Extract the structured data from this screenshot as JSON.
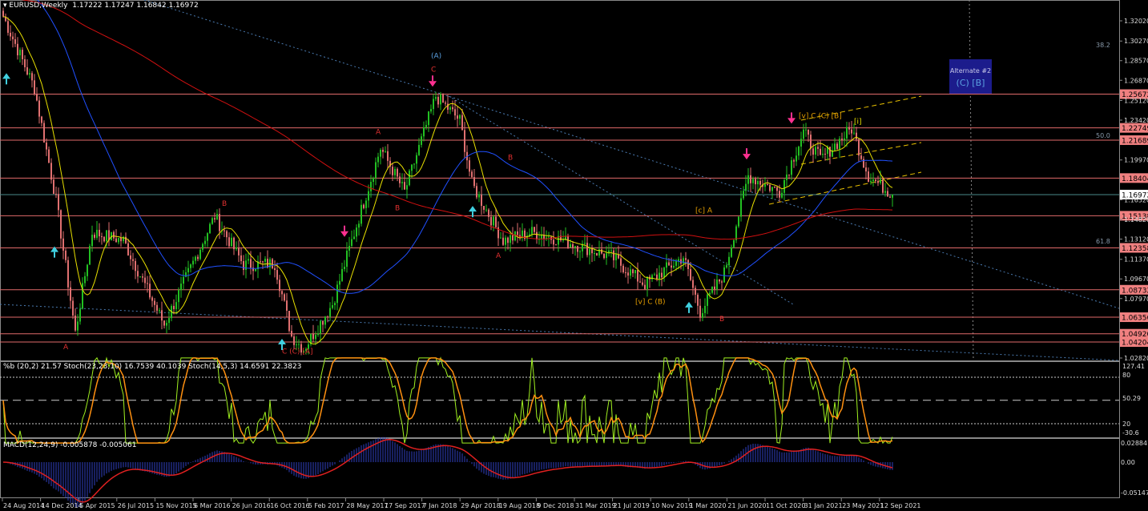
{
  "header": {
    "symbol": "EURUSD,Weekly",
    "ohlc": "1.17222 1.17247 1.16842 1.16972"
  },
  "indicator_header": "%b (20,2) 21.57  Stoch(23,23,10) 16.7539 40.1039  Stoch(14,5,3) 14.6591 22.3823",
  "macd_header": "MACD(12,24,9) -0.005878 -0.005061",
  "alternate_box": {
    "title": "Alternate #2",
    "labels": "(C)  [B]"
  },
  "colors": {
    "bull": "#22c022",
    "bear": "#e07070",
    "level": "#e06a6a",
    "ma_fast": "#e8e000",
    "ma_mid": "#2050ff",
    "ma_slow": "#d01010",
    "stoch": "#a0f020",
    "stoch_signal": "#ff9010",
    "macd_signal": "#e02020",
    "macd_hist": "#3040c0"
  },
  "chart_data": {
    "type": "candlestick",
    "title": "EURUSD,Weekly",
    "ylim": [
      1.0282,
      1.3202
    ],
    "price_ticks": [
      "1.32020",
      "1.30270",
      "1.28570",
      "1.26870",
      "1.25120",
      "1.23420",
      "1.19970",
      "1.16520",
      "1.14820",
      "1.13120",
      "1.11370",
      "1.09670",
      "1.07970",
      "1.02820"
    ],
    "levels": [
      1.25672,
      1.22749,
      1.21689,
      1.18404,
      1.15138,
      1.12358,
      1.08732,
      1.06356,
      1.0492,
      1.04204
    ],
    "level_labels": [
      "1.25672",
      "1.22749",
      "1.21689",
      "1.18404",
      "1.15138",
      "1.12358",
      "1.08732",
      "1.06356",
      "1.04920",
      "1.04204"
    ],
    "current_price": 1.16972,
    "current_price_label": "1.16972",
    "fib_labels": [
      {
        "text": "38.2",
        "price": 1.296
      },
      {
        "text": "50.0",
        "price": 1.2175
      },
      {
        "text": "61.8",
        "price": 1.126
      }
    ],
    "x_labels": [
      "24 Aug 2014",
      "14 Dec 2014",
      "5 Apr 2015",
      "26 Jul 2015",
      "15 Nov 2015",
      "6 Mar 2016",
      "26 Jun 2016",
      "16 Oct 2016",
      "5 Feb 2017",
      "28 May 2017",
      "17 Sep 2017",
      "7 Jan 2018",
      "29 Apr 2018",
      "19 Aug 2018",
      "9 Dec 2018",
      "31 Mar 2019",
      "21 Jul 2019",
      "10 Nov 2019",
      "1 Mar 2020",
      "21 Jun 2020",
      "11 Oct 2020",
      "31 Jan 2021",
      "23 May 2021",
      "12 Sep 2021"
    ],
    "close_path_week_price": [
      [
        0,
        1.324
      ],
      [
        13,
        1.262
      ],
      [
        22,
        1.165
      ],
      [
        30,
        1.05
      ],
      [
        37,
        1.137
      ],
      [
        50,
        1.13
      ],
      [
        67,
        1.057
      ],
      [
        88,
        1.151
      ],
      [
        100,
        1.109
      ],
      [
        113,
        1.11
      ],
      [
        120,
        1.047
      ],
      [
        125,
        1.036
      ],
      [
        137,
        1.075
      ],
      [
        143,
        1.116
      ],
      [
        157,
        1.21
      ],
      [
        167,
        1.172
      ],
      [
        180,
        1.255
      ],
      [
        190,
        1.234
      ],
      [
        195,
        1.179
      ],
      [
        208,
        1.13
      ],
      [
        220,
        1.137
      ],
      [
        233,
        1.13
      ],
      [
        253,
        1.116
      ],
      [
        267,
        1.092
      ],
      [
        283,
        1.116
      ],
      [
        290,
        1.068
      ],
      [
        300,
        1.102
      ],
      [
        310,
        1.186
      ],
      [
        323,
        1.172
      ],
      [
        333,
        1.224
      ],
      [
        340,
        1.2
      ],
      [
        353,
        1.227
      ],
      [
        360,
        1.186
      ],
      [
        370,
        1.1697
      ]
    ],
    "wave_labels": [
      {
        "text": "(A)",
        "week": 180,
        "price": 1.288,
        "color": "#5aa0e0"
      },
      {
        "text": "C",
        "week": 180,
        "price": 1.276,
        "color": "#e03030"
      },
      {
        "text": "A",
        "week": 27,
        "price": 1.036,
        "color": "#e03030"
      },
      {
        "text": "B",
        "week": 93,
        "price": 1.16,
        "color": "#e03030"
      },
      {
        "text": "C (C) [A]",
        "week": 118,
        "price": 1.032,
        "color": "#e03030"
      },
      {
        "text": "A",
        "week": 157,
        "price": 1.222,
        "color": "#e03030"
      },
      {
        "text": "B",
        "week": 165,
        "price": 1.156,
        "color": "#e03030"
      },
      {
        "text": "B",
        "week": 212,
        "price": 1.2,
        "color": "#e03030"
      },
      {
        "text": "A",
        "week": 207,
        "price": 1.115,
        "color": "#e03030"
      },
      {
        "text": "[v] C (B)",
        "week": 265,
        "price": 1.075,
        "color": "#e8a000"
      },
      {
        "text": "[c] A",
        "week": 290,
        "price": 1.154,
        "color": "#e8a000"
      },
      {
        "text": "B",
        "week": 300,
        "price": 1.06,
        "color": "#e03030"
      },
      {
        "text": "[v] C (C) [B]",
        "week": 333,
        "price": 1.236,
        "color": "#e8a000"
      },
      {
        "text": "[i]",
        "week": 356,
        "price": 1.231,
        "color": "#e8e000"
      }
    ]
  },
  "indicator_panel": {
    "ticks": [
      "127.41",
      "80",
      "50.29",
      "20",
      "-30.6"
    ]
  },
  "macd_panel": {
    "ticks": [
      "0.028847",
      "0.00",
      "-0.051476"
    ]
  }
}
